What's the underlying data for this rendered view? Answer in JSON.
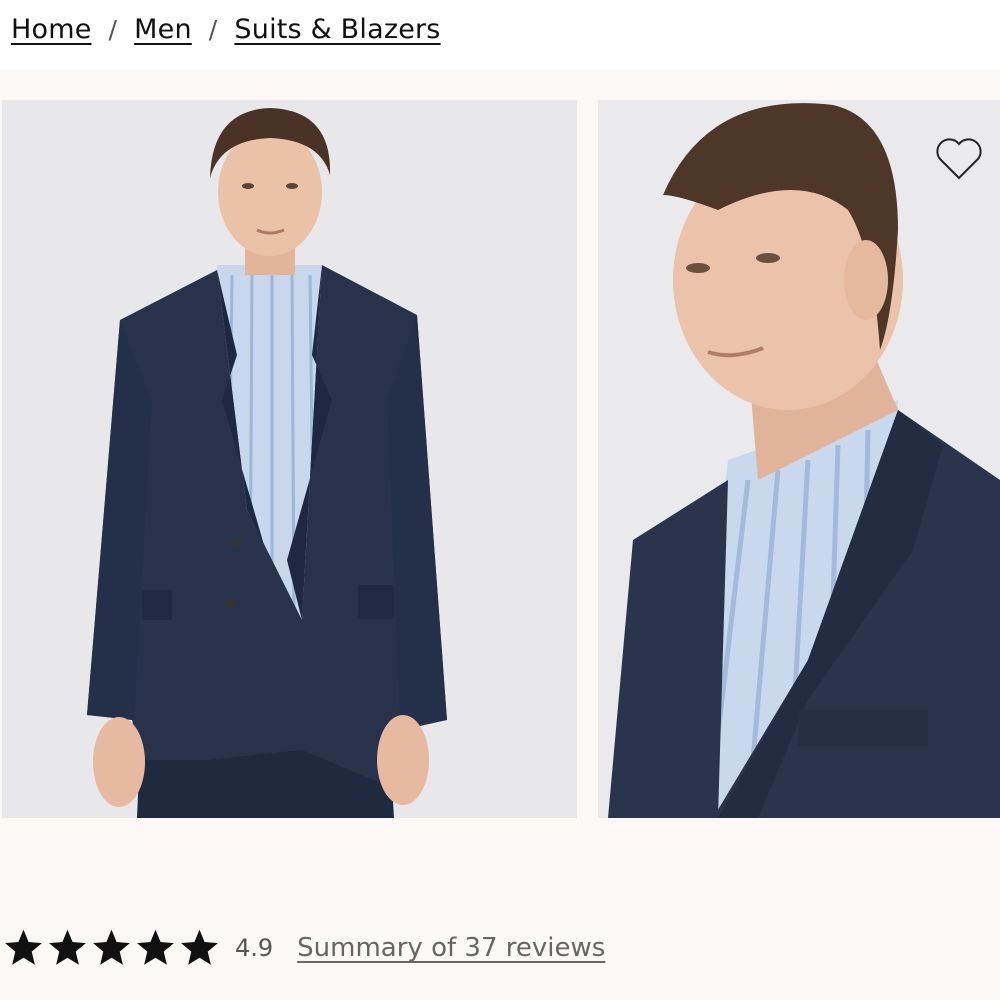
{
  "breadcrumb": {
    "items": [
      "Home",
      "Men",
      "Suits & Blazers"
    ],
    "separator": "/"
  },
  "gallery": {
    "images": [
      {
        "alt": "Model in navy suit jacket and blue striped shirt",
        "icon": "product-photo-front"
      },
      {
        "alt": "Close-up of model in navy blazer",
        "icon": "product-photo-detail"
      }
    ],
    "favorite_icon": "heart-outline-icon"
  },
  "rating": {
    "value": "4.9",
    "stars": 5,
    "reviews_label": "Summary of 37 reviews"
  },
  "colors": {
    "background": "#fbf8f6",
    "jacket": "#27324a",
    "shirt": "#c9d8ec",
    "star": "#111111"
  }
}
